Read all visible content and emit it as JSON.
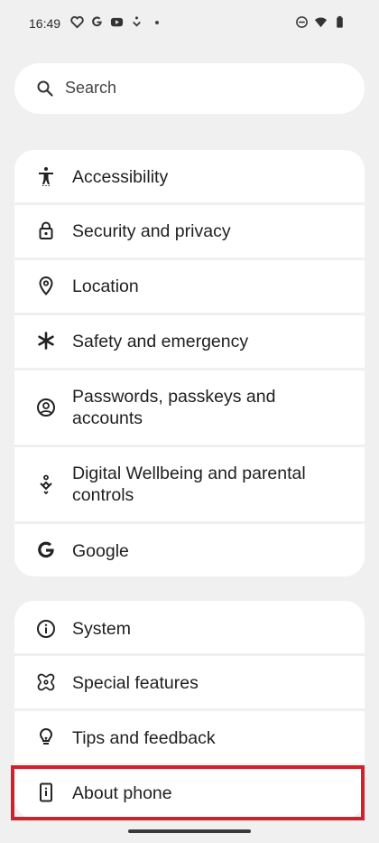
{
  "status_bar": {
    "time": "16:49",
    "left_icons": [
      "heart-app-icon",
      "google-g-icon",
      "youtube-icon",
      "wellbeing-icon",
      "dot"
    ],
    "right_icons": [
      "do-not-disturb-icon",
      "wifi-icon",
      "battery-icon"
    ]
  },
  "search": {
    "label": "Search"
  },
  "group1": {
    "items": [
      {
        "label": "Accessibility",
        "icon": "accessibility-icon"
      },
      {
        "label": "Security and privacy",
        "icon": "lock-icon"
      },
      {
        "label": "Location",
        "icon": "location-pin-icon"
      },
      {
        "label": "Safety and emergency",
        "icon": "asterisk-icon"
      },
      {
        "label": "Passwords, passkeys and accounts",
        "icon": "account-circle-icon"
      },
      {
        "label": "Digital Wellbeing and parental controls",
        "icon": "wellbeing-icon"
      },
      {
        "label": "Google",
        "icon": "google-g-icon"
      }
    ]
  },
  "group2": {
    "items": [
      {
        "label": "System",
        "icon": "info-icon"
      },
      {
        "label": "Special features",
        "icon": "special-features-icon"
      },
      {
        "label": "Tips and feedback",
        "icon": "lightbulb-icon"
      },
      {
        "label": "About phone",
        "icon": "phone-info-icon"
      }
    ]
  },
  "colors": {
    "background": "#f0f0f0",
    "card": "#ffffff",
    "highlight": "#d3202a"
  }
}
